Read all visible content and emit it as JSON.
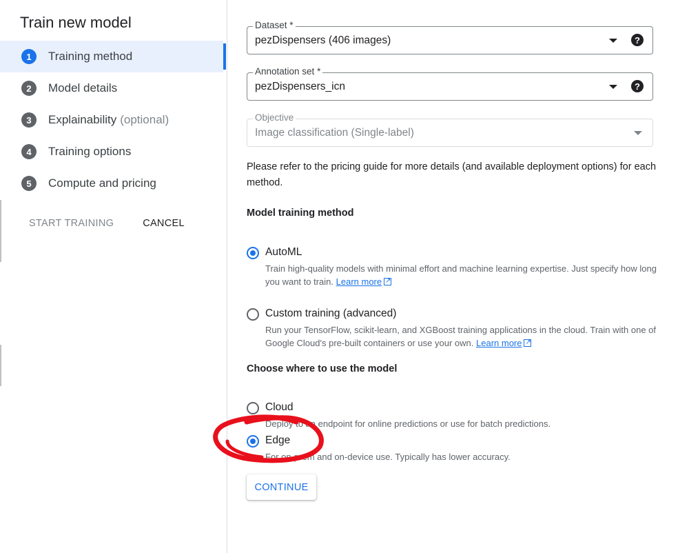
{
  "sidebar": {
    "title": "Train new model",
    "steps": [
      {
        "num": "1",
        "label": "Training method",
        "optional": ""
      },
      {
        "num": "2",
        "label": "Model details",
        "optional": ""
      },
      {
        "num": "3",
        "label": "Explainability",
        "optional": "(optional)"
      },
      {
        "num": "4",
        "label": "Training options",
        "optional": ""
      },
      {
        "num": "5",
        "label": "Compute and pricing",
        "optional": ""
      }
    ],
    "start_training": "START TRAINING",
    "cancel": "CANCEL"
  },
  "form": {
    "dataset": {
      "label": "Dataset *",
      "value": "pezDispensers (406 images)",
      "help": "?"
    },
    "annotation_set": {
      "label": "Annotation set *",
      "value": "pezDispensers_icn",
      "help": "?"
    },
    "objective": {
      "label": "Objective",
      "value": "Image classification (Single-label)"
    },
    "info": "Please refer to the pricing guide for more details (and available deployment options) for each method.",
    "training_method_title": "Model training method",
    "automl": {
      "label": "AutoML",
      "desc": "Train high-quality models with minimal effort and machine learning expertise. Just specify how long you want to train.",
      "link": "Learn more"
    },
    "custom": {
      "label": "Custom training (advanced)",
      "desc": "Run your TensorFlow, scikit-learn, and XGBoost training applications in the cloud. Train with one of Google Cloud's pre-built containers or use your own.",
      "link": "Learn more"
    },
    "where_title": "Choose where to use the model",
    "cloud": {
      "label": "Cloud",
      "desc": "Deploy to an endpoint for online predictions or use for batch predictions."
    },
    "edge": {
      "label": "Edge",
      "desc": "For on-prem and on-device use. Typically has lower accuracy."
    },
    "continue": "CONTINUE"
  },
  "colors": {
    "accent": "#1a73e8",
    "annotation": "#e8101c"
  }
}
